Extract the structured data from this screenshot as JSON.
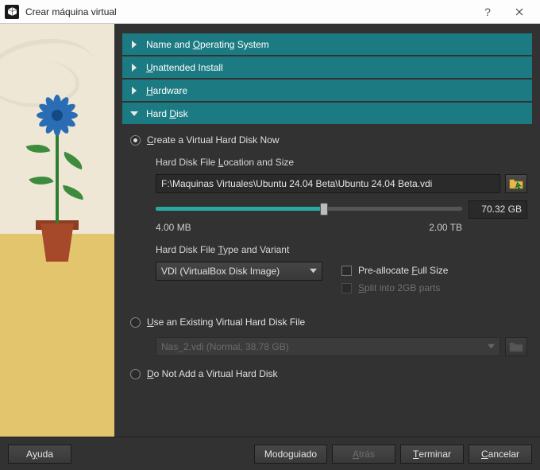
{
  "window": {
    "title": "Crear máquina virtual"
  },
  "sections": {
    "name_os": "Name and Operating System",
    "name_os_ul": "O",
    "unattended": "Unattended Install",
    "unattended_ul": "U",
    "hardware": "Hardware",
    "hardware_ul": "H",
    "hard_disk": "Hard Disk",
    "hard_disk_ul": "D"
  },
  "hard_disk": {
    "radio_create": "Create a Virtual Hard Disk Now",
    "radio_create_ul": "C",
    "loc_size_label": "Hard Disk File Location and Size",
    "loc_size_ul": "L",
    "path": "F:\\Maquinas Virtuales\\Ubuntu 24.04 Beta\\Ubuntu 24.04 Beta.vdi",
    "size_display": "70.32 GB",
    "scale_min": "4.00 MB",
    "scale_max": "2.00 TB",
    "slider_percent": 55,
    "type_variant_label": "Hard Disk File Type and Variant",
    "type_variant_ul": "T",
    "file_type": "VDI (VirtualBox Disk Image)",
    "preallocate": "Pre-allocate Full Size",
    "preallocate_ul": "F",
    "split": "Split into 2GB parts",
    "split_ul": "S",
    "radio_existing": "Use an Existing Virtual Hard Disk File",
    "radio_existing_ul": "U",
    "existing_value": "Nas_2.vdi (Normal, 38.78 GB)",
    "radio_none": "Do Not Add a Virtual Hard Disk",
    "radio_none_ul": "D"
  },
  "buttons": {
    "help": "Ayuda",
    "help_ul": "y",
    "guided": "Modo guiado",
    "guided_ul": "g",
    "back": "Atrás",
    "back_ul": "A",
    "finish": "Terminar",
    "finish_ul": "T",
    "cancel": "Cancelar",
    "cancel_ul": "C"
  }
}
